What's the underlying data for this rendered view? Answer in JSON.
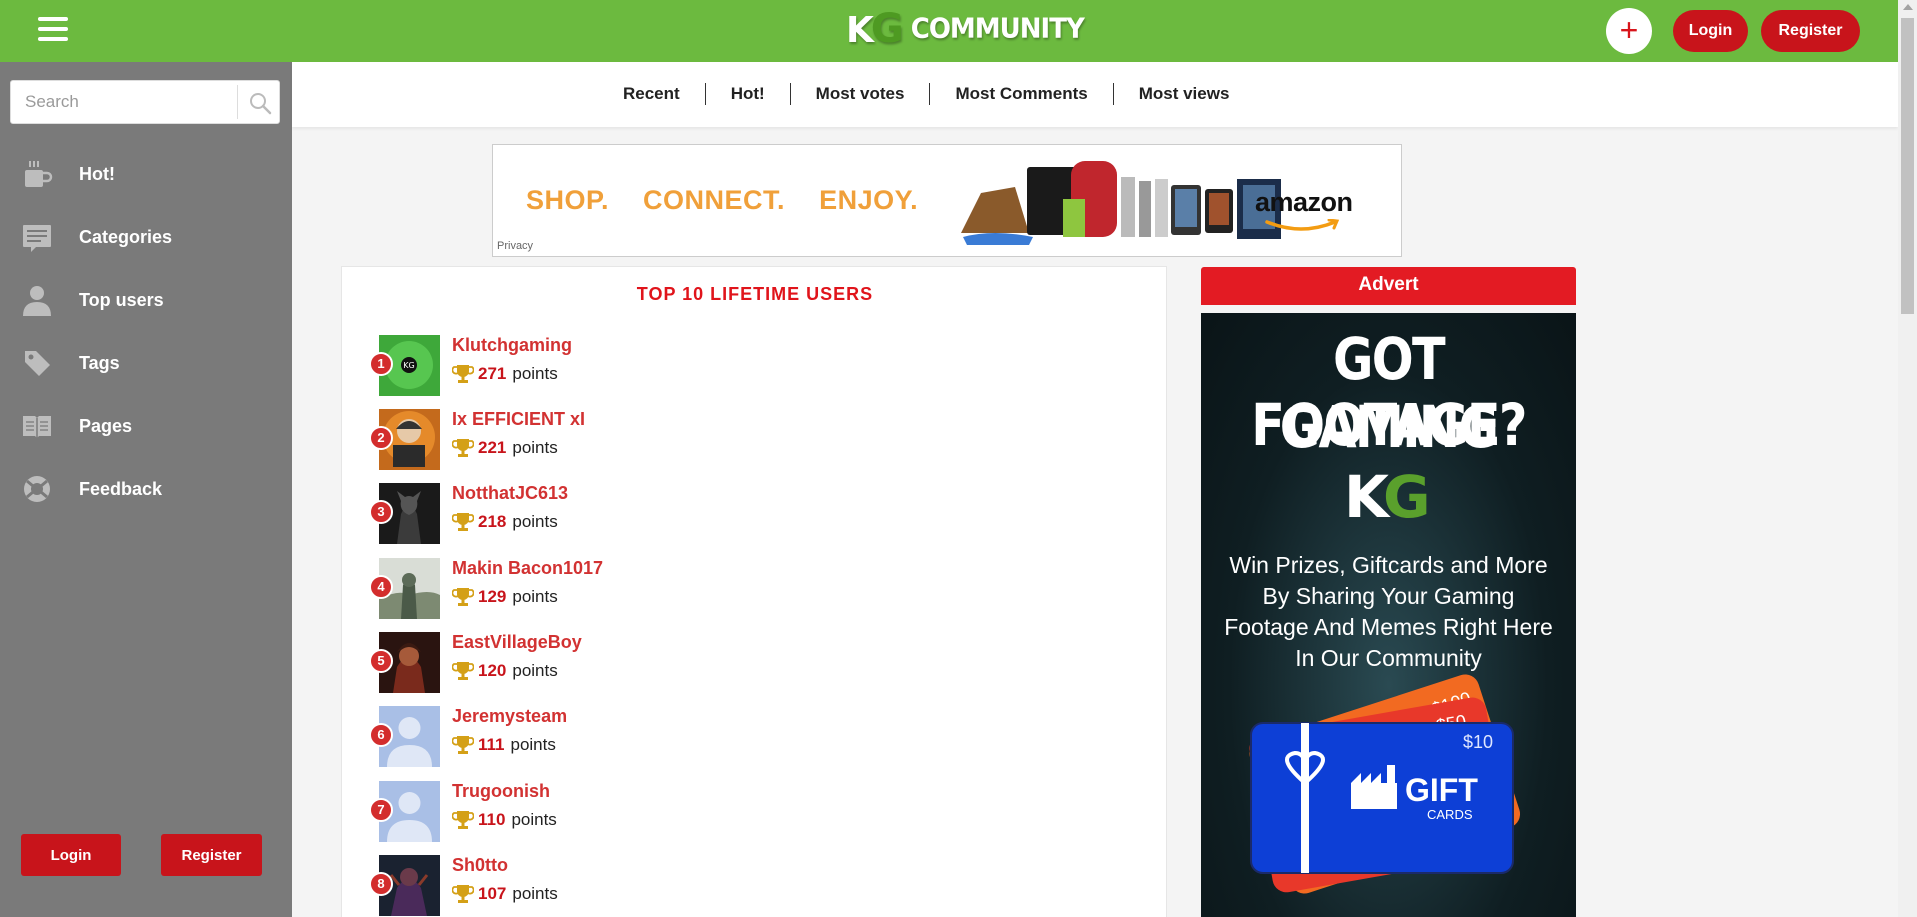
{
  "header": {
    "logo_text": "COMMUNITY",
    "logo_k": "K",
    "logo_g": "G",
    "plus_label": "+",
    "login_label": "Login",
    "register_label": "Register"
  },
  "search": {
    "placeholder": "Search"
  },
  "sidebar": {
    "items": [
      {
        "label": "Hot!",
        "icon": "coffee-cup-icon"
      },
      {
        "label": "Categories",
        "icon": "categories-icon"
      },
      {
        "label": "Top users",
        "icon": "user-icon"
      },
      {
        "label": "Tags",
        "icon": "tag-icon"
      },
      {
        "label": "Pages",
        "icon": "book-icon"
      },
      {
        "label": "Feedback",
        "icon": "lifebuoy-icon"
      }
    ],
    "login_label": "Login",
    "register_label": "Register"
  },
  "sort_tabs": [
    "Recent",
    "Hot!",
    "Most votes",
    "Most Comments",
    "Most views"
  ],
  "banner": {
    "words": [
      "SHOP.",
      "CONNECT.",
      "ENJOY."
    ],
    "brand": "amazon",
    "privacy": "Privacy"
  },
  "top_users": {
    "title": "TOP 10 LIFETIME USERS",
    "points_label": "points",
    "users": [
      {
        "rank": "1",
        "name": "Klutchgaming",
        "points": "271"
      },
      {
        "rank": "2",
        "name": "Ix EFFICIENT xI",
        "points": "221"
      },
      {
        "rank": "3",
        "name": "NotthatJC613",
        "points": "218"
      },
      {
        "rank": "4",
        "name": "Makin Bacon1017",
        "points": "129"
      },
      {
        "rank": "5",
        "name": "EastVillageBoy",
        "points": "120"
      },
      {
        "rank": "6",
        "name": "Jeremysteam",
        "points": "111"
      },
      {
        "rank": "7",
        "name": "Trugoonish",
        "points": "110"
      },
      {
        "rank": "8",
        "name": "Sh0tto",
        "points": "107"
      }
    ]
  },
  "advert": {
    "heading": "Advert",
    "line1": "GOT GAMING",
    "line2": "FOOTAGE?",
    "kg_k": "K",
    "kg_g": "G",
    "body": "Win Prizes, Giftcards and More By Sharing Your Gaming Footage And Memes Right Here In Our Community",
    "card_values": [
      "$100",
      "$50",
      "$10"
    ],
    "card_title": "GIFT",
    "card_sub": "CARDS"
  },
  "colors": {
    "brand_green": "#6cba3f",
    "accent_red": "#c8141b",
    "sidebar_gray": "#7a7a7a",
    "title_red": "#e0141b"
  }
}
